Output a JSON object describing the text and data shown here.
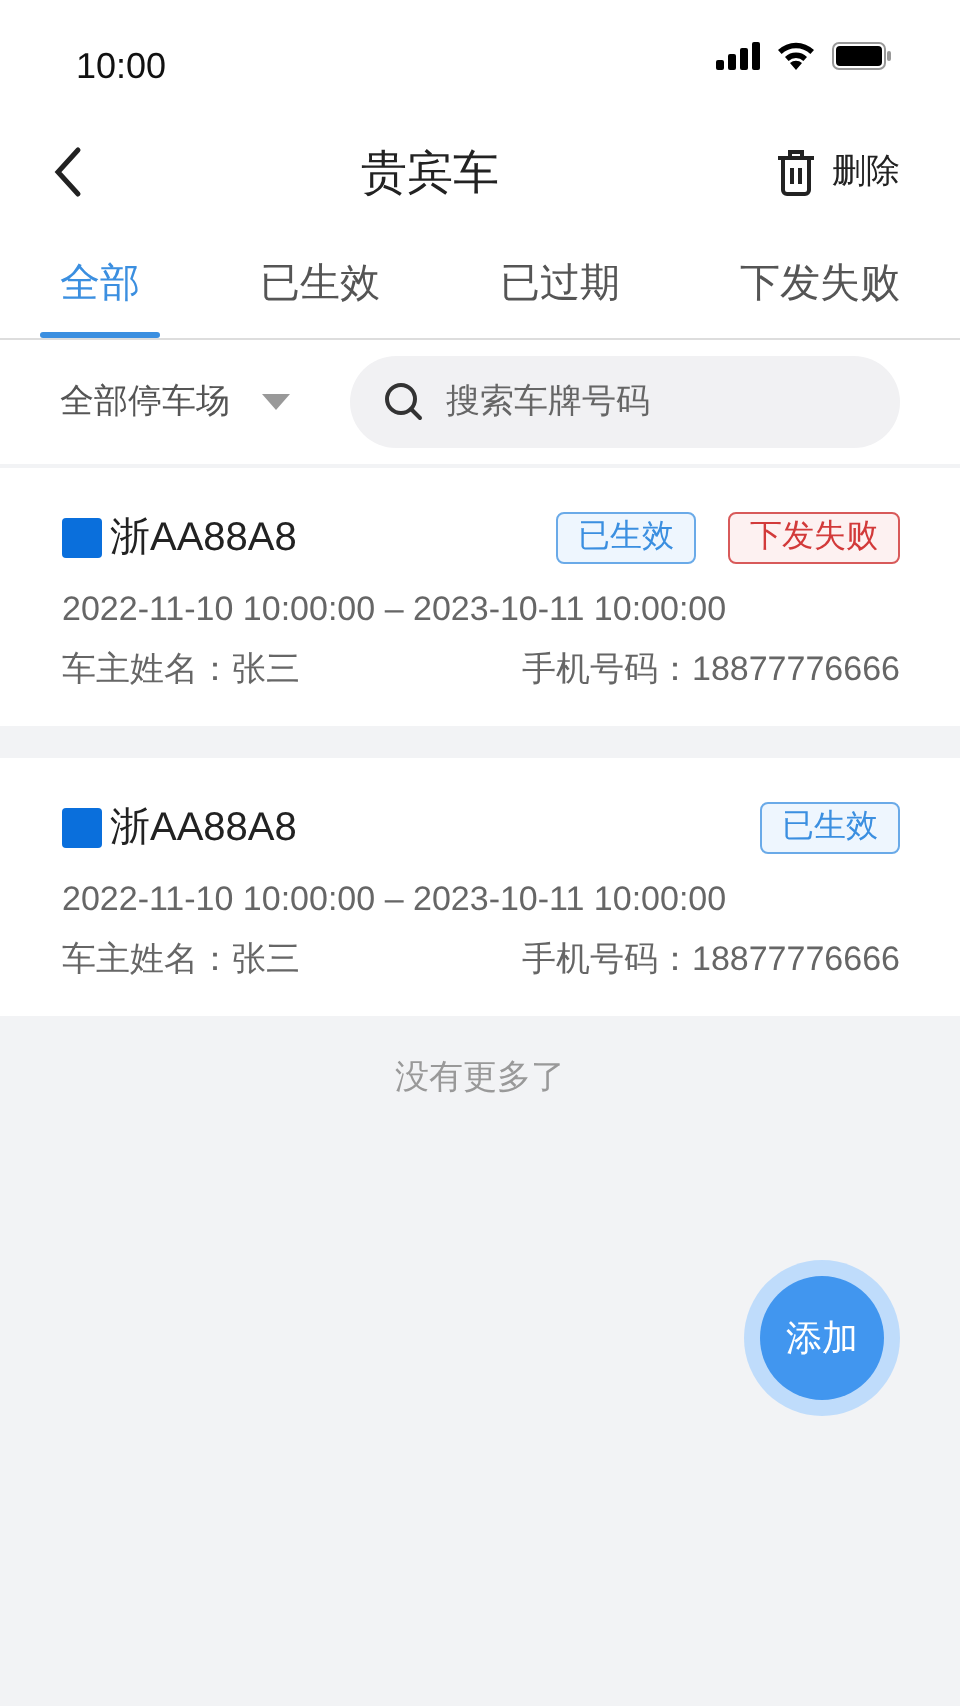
{
  "status_bar": {
    "time": "10:00"
  },
  "header": {
    "title": "贵宾车",
    "action": "删除"
  },
  "tabs": [
    {
      "label": "全部",
      "selected": true
    },
    {
      "label": "已生效",
      "selected": false
    },
    {
      "label": "已过期",
      "selected": false
    },
    {
      "label": "下发失败",
      "selected": false
    }
  ],
  "filter": {
    "lot": "全部停车场",
    "search_placeholder": "搜索车牌号码"
  },
  "vehicles": [
    {
      "plate": "浙AA88A8",
      "color": "#0a6fdc",
      "tags": [
        {
          "label": "已生效",
          "kind": "effective"
        },
        {
          "label": "下发失败",
          "kind": "failed"
        }
      ],
      "period": "2022-11-10 10:00:00 – 2023-10-11 10:00:00",
      "owner": "车主姓名：张三",
      "phone": "手机号码：18877776666"
    },
    {
      "plate": "浙AA88A8",
      "color": "#0a6fdc",
      "tags": [
        {
          "label": "已生效",
          "kind": "effective"
        }
      ],
      "period": "2022-11-10 10:00:00 – 2023-10-11 10:00:00",
      "owner": "车主姓名：张三",
      "phone": "手机号码：18877776666"
    }
  ],
  "list_end": "没有更多了",
  "fab": "添加"
}
